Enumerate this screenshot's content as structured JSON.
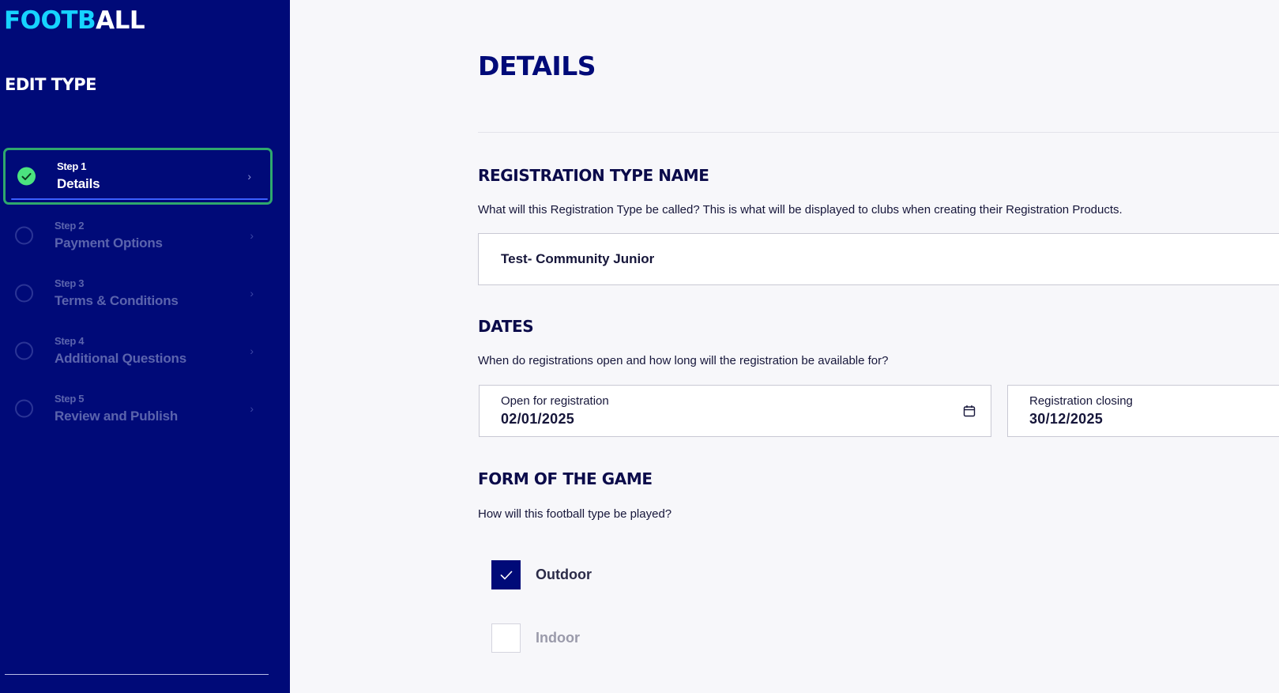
{
  "brand": {
    "logo_part1": "FOOTB",
    "logo_part2": "ALL"
  },
  "sidebar": {
    "heading": "EDIT TYPE",
    "steps": [
      {
        "step": "Step 1",
        "label": "Details",
        "status": "complete",
        "active": true
      },
      {
        "step": "Step 2",
        "label": "Payment Options",
        "status": "pending",
        "active": false
      },
      {
        "step": "Step 3",
        "label": "Terms & Conditions",
        "status": "pending",
        "active": false
      },
      {
        "step": "Step 4",
        "label": "Additional Questions",
        "status": "pending",
        "active": false
      },
      {
        "step": "Step 5",
        "label": "Review and Publish",
        "status": "pending",
        "active": false
      }
    ]
  },
  "main": {
    "title": "DETAILS",
    "registration_type": {
      "heading": "REGISTRATION TYPE NAME",
      "description": "What will this Registration Type be called? This is what will be displayed to clubs when creating their Registration Products.",
      "value": "Test- Community Junior"
    },
    "dates": {
      "heading": "DATES",
      "description": "When do registrations open and how long will the registration be available for?",
      "open": {
        "label": "Open for registration",
        "value": "02/01/2025"
      },
      "closing": {
        "label": "Registration closing",
        "value": "30/12/2025"
      }
    },
    "form_of_game": {
      "heading": "FORM OF THE GAME",
      "description": "How will this football type be played?",
      "options": [
        {
          "label": "Outdoor",
          "checked": true
        },
        {
          "label": "Indoor",
          "checked": false
        }
      ]
    }
  },
  "colors": {
    "sidebar_bg": "#000a78",
    "accent_cyan": "#16d3ff",
    "active_border": "#2fa86d",
    "check_green": "#4be37f",
    "page_bg": "#f7f7fa"
  }
}
